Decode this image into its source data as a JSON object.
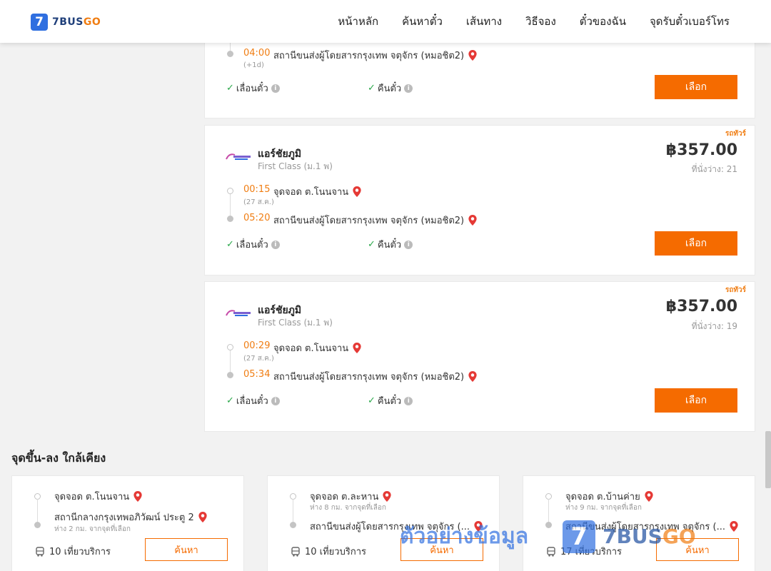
{
  "header": {
    "logo_mark": "7",
    "logo_text_a": "7BUS",
    "logo_text_b": "GO",
    "nav": [
      "หน้าหลัก",
      "ค้นหาตั๋ว",
      "เส้นทาง",
      "วิธีจอง",
      "ตั๋วของฉัน",
      "จุดรับตั๋วเบอร์โทร"
    ]
  },
  "top_card": {
    "arrive_time": "04:00",
    "arrive_stop": "สถานีขนส่งผู้โดยสารกรุงเทพ จตุจักร (หมอชิต2)",
    "arrive_note": "(+1d)",
    "opt_reschedule": "เลื่อนตั๋ว",
    "opt_refund": "คืนตั๋ว",
    "select_label": "เลือก"
  },
  "trips": [
    {
      "tag": "รถทัวร์",
      "operator": "แอร์ชัยภูมิ",
      "class": "First Class (ม.1 พ)",
      "price": "฿357.00",
      "seats": "ที่นั่งว่าง: 21",
      "depart_time": "00:15",
      "depart_stop": "จุดจอด ต.โนนจาน",
      "depart_date": "(27 ส.ค.)",
      "arrive_time": "05:20",
      "arrive_stop": "สถานีขนส่งผู้โดยสารกรุงเทพ จตุจักร (หมอชิต2)",
      "opt_reschedule": "เลื่อนตั๋ว",
      "opt_refund": "คืนตั๋ว",
      "select_label": "เลือก"
    },
    {
      "tag": "รถทัวร์",
      "operator": "แอร์ชัยภูมิ",
      "class": "First Class (ม.1 พ)",
      "price": "฿357.00",
      "seats": "ที่นั่งว่าง: 19",
      "depart_time": "00:29",
      "depart_stop": "จุดจอด ต.โนนจาน",
      "depart_date": "(27 ส.ค.)",
      "arrive_time": "05:34",
      "arrive_stop": "สถานีขนส่งผู้โดยสารกรุงเทพ จตุจักร (หมอชิต2)",
      "opt_reschedule": "เลื่อนตั๋ว",
      "opt_refund": "คืนตั๋ว",
      "select_label": "เลือก"
    }
  ],
  "nearby": {
    "title": "จุดขึ้น-ลง ใกล้เคียง",
    "cards": [
      {
        "from": "จุดจอด ต.โนนจาน",
        "from_dist": "",
        "to": "สถานีกลางกรุงเทพอภิวัฒน์ ประตู 2",
        "to_dist": "ห่าง 2 กม. จากจุดที่เลือก",
        "trips": "10 เที่ยวบริการ",
        "search_label": "ค้นหา"
      },
      {
        "from": "จุดจอด ต.ละหาน",
        "from_dist": "ห่าง 8 กม. จากจุดที่เลือก",
        "to": "สถานีขนส่งผู้โดยสารกรุงเทพ จตุจักร (...",
        "to_dist": "",
        "trips": "10 เที่ยวบริการ",
        "search_label": "ค้นหา"
      },
      {
        "from": "จุดจอด ต.บ้านค่าย",
        "from_dist": "ห่าง 9 กม. จากจุดที่เลือก",
        "to": "สถานีขนส่งผู้โดยสารกรุงเทพ จตุจักร (...",
        "to_dist": "",
        "trips": "17 เที่ยวบริการ",
        "search_label": "ค้นหา"
      }
    ]
  },
  "watermark": {
    "text": "ตัวอย่างข้อมูล",
    "mark": "7",
    "brand_a": "7BUS",
    "brand_b": "GO"
  },
  "colors": {
    "accent": "#f56b00",
    "time": "#f07d12",
    "check": "#2aa84a",
    "pin": "#e53935",
    "brand_blue": "#2f6fe0"
  },
  "icons": [
    "location-pin-icon",
    "check-icon",
    "info-icon",
    "bus-icon",
    "operator-logo"
  ]
}
